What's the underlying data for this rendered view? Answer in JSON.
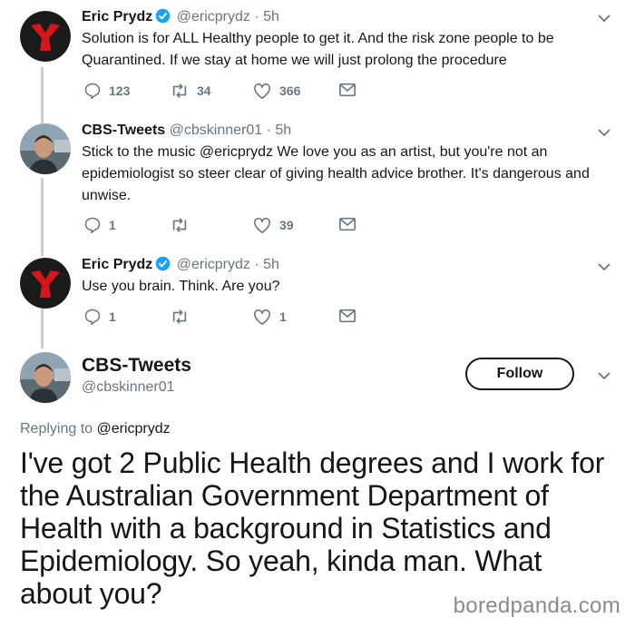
{
  "tweets": [
    {
      "name": "Eric Prydz",
      "handle": "@ericprydz",
      "dot": "·",
      "time": "5h",
      "text": "Solution is for ALL Healthy people to get it. And the risk zone people to be Quarantined.  If we stay at home we will just prolong the procedure",
      "replies": "123",
      "retweets": "34",
      "likes": "366",
      "verified": true
    },
    {
      "name": "CBS-Tweets",
      "handle": "@cbskinner01",
      "dot": "·",
      "time": "5h",
      "text": "Stick to the music @ericprydz We love you as an artist, but you're not an epidemiologist so steer clear of giving health advice brother. It's dangerous and unwise.",
      "replies": "1",
      "retweets": "",
      "likes": "39",
      "verified": false
    },
    {
      "name": "Eric Prydz",
      "handle": "@ericprydz",
      "dot": "·",
      "time": "5h",
      "text": "Use you brain. Think.  Are you?",
      "replies": "1",
      "retweets": "",
      "likes": "1",
      "verified": true
    }
  ],
  "main": {
    "name": "CBS-Tweets",
    "handle": "@cbskinner01",
    "follow_label": "Follow",
    "replying_label": "Replying to",
    "replying_to": "@ericprydz",
    "text": "I've got 2 Public Health degrees and I work for the Australian Government Department of Health with a background in Statistics and Epidemiology. So yeah, kinda man. What about you?"
  },
  "watermark": "boredpanda.com",
  "colors": {
    "text": "#14171a",
    "muted": "#657786",
    "verified": "#1da1f2",
    "thread_line": "#c4cfd6"
  }
}
